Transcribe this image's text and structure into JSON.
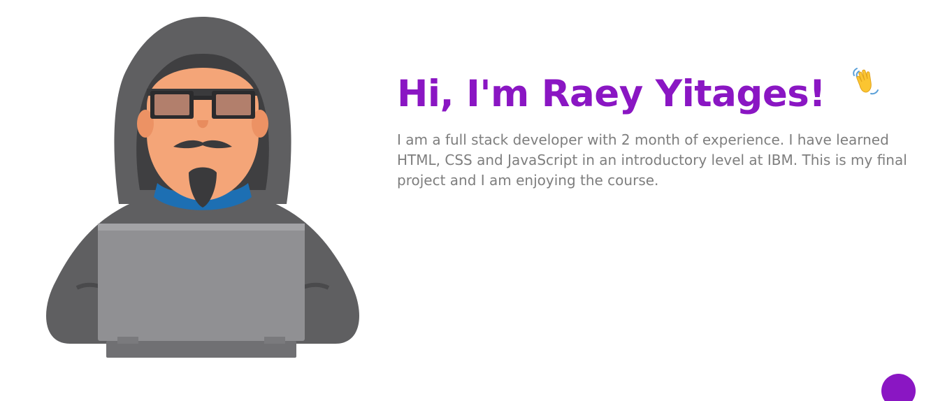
{
  "hero": {
    "title": "Hi, I'm Raey Yitages!",
    "wave_icon": "waving-hand-icon",
    "description": "I am a full stack developer with 2 month of experience. I have learned HTML, CSS and JavaScript in an introductory level at IBM. This is my final project and I am enjoying the course.",
    "illustration": "hooded-hacker-laptop-illustration"
  },
  "scroll_top_button": {
    "icon": "scroll-top-circle"
  },
  "colors": {
    "accent": "#8a16c3",
    "body_text": "#7e7e7e",
    "background": "#ffffff"
  }
}
